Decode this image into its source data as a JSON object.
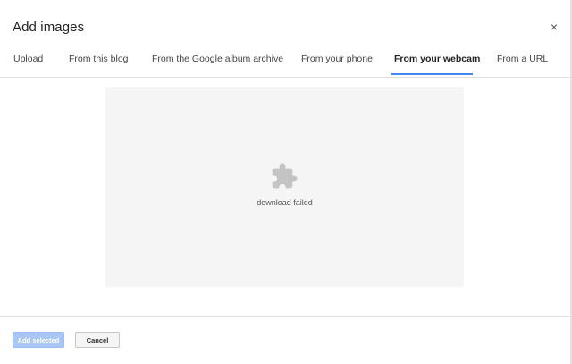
{
  "dialog": {
    "title": "Add images",
    "close_label": "×"
  },
  "tabs": [
    {
      "label": "Upload",
      "active": false
    },
    {
      "label": "From this blog",
      "active": false
    },
    {
      "label": "From the Google album archive",
      "active": false
    },
    {
      "label": "From your phone",
      "active": false
    },
    {
      "label": "From your webcam",
      "active": true
    },
    {
      "label": "From a URL",
      "active": false
    }
  ],
  "preview": {
    "icon": "puzzle-piece-icon",
    "status_text": "download failed"
  },
  "footer": {
    "add_selected_label": "Add selected",
    "cancel_label": "Cancel"
  },
  "colors": {
    "accent": "#4285f4",
    "primary_disabled": "#a9c6f4",
    "preview_bg": "#f5f5f5"
  }
}
